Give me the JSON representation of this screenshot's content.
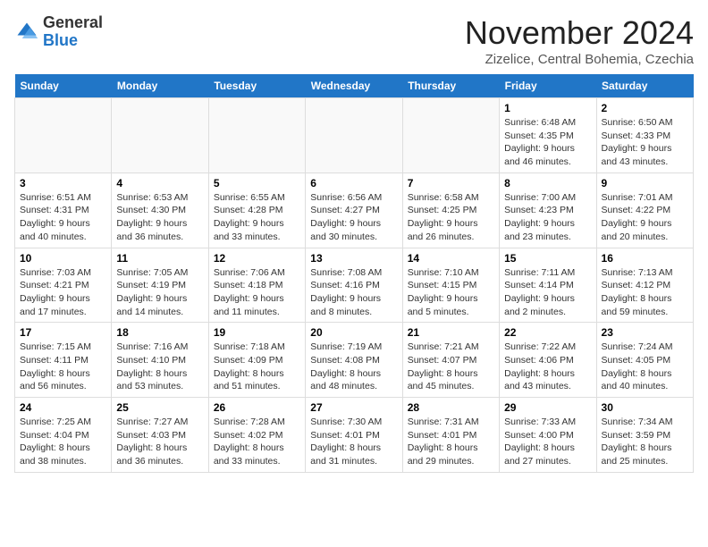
{
  "header": {
    "logo_general": "General",
    "logo_blue": "Blue",
    "month_title": "November 2024",
    "location": "Zizelice, Central Bohemia, Czechia"
  },
  "weekdays": [
    "Sunday",
    "Monday",
    "Tuesday",
    "Wednesday",
    "Thursday",
    "Friday",
    "Saturday"
  ],
  "weeks": [
    [
      {
        "day": "",
        "info": ""
      },
      {
        "day": "",
        "info": ""
      },
      {
        "day": "",
        "info": ""
      },
      {
        "day": "",
        "info": ""
      },
      {
        "day": "",
        "info": ""
      },
      {
        "day": "1",
        "info": "Sunrise: 6:48 AM\nSunset: 4:35 PM\nDaylight: 9 hours and 46 minutes."
      },
      {
        "day": "2",
        "info": "Sunrise: 6:50 AM\nSunset: 4:33 PM\nDaylight: 9 hours and 43 minutes."
      }
    ],
    [
      {
        "day": "3",
        "info": "Sunrise: 6:51 AM\nSunset: 4:31 PM\nDaylight: 9 hours and 40 minutes."
      },
      {
        "day": "4",
        "info": "Sunrise: 6:53 AM\nSunset: 4:30 PM\nDaylight: 9 hours and 36 minutes."
      },
      {
        "day": "5",
        "info": "Sunrise: 6:55 AM\nSunset: 4:28 PM\nDaylight: 9 hours and 33 minutes."
      },
      {
        "day": "6",
        "info": "Sunrise: 6:56 AM\nSunset: 4:27 PM\nDaylight: 9 hours and 30 minutes."
      },
      {
        "day": "7",
        "info": "Sunrise: 6:58 AM\nSunset: 4:25 PM\nDaylight: 9 hours and 26 minutes."
      },
      {
        "day": "8",
        "info": "Sunrise: 7:00 AM\nSunset: 4:23 PM\nDaylight: 9 hours and 23 minutes."
      },
      {
        "day": "9",
        "info": "Sunrise: 7:01 AM\nSunset: 4:22 PM\nDaylight: 9 hours and 20 minutes."
      }
    ],
    [
      {
        "day": "10",
        "info": "Sunrise: 7:03 AM\nSunset: 4:21 PM\nDaylight: 9 hours and 17 minutes."
      },
      {
        "day": "11",
        "info": "Sunrise: 7:05 AM\nSunset: 4:19 PM\nDaylight: 9 hours and 14 minutes."
      },
      {
        "day": "12",
        "info": "Sunrise: 7:06 AM\nSunset: 4:18 PM\nDaylight: 9 hours and 11 minutes."
      },
      {
        "day": "13",
        "info": "Sunrise: 7:08 AM\nSunset: 4:16 PM\nDaylight: 9 hours and 8 minutes."
      },
      {
        "day": "14",
        "info": "Sunrise: 7:10 AM\nSunset: 4:15 PM\nDaylight: 9 hours and 5 minutes."
      },
      {
        "day": "15",
        "info": "Sunrise: 7:11 AM\nSunset: 4:14 PM\nDaylight: 9 hours and 2 minutes."
      },
      {
        "day": "16",
        "info": "Sunrise: 7:13 AM\nSunset: 4:12 PM\nDaylight: 8 hours and 59 minutes."
      }
    ],
    [
      {
        "day": "17",
        "info": "Sunrise: 7:15 AM\nSunset: 4:11 PM\nDaylight: 8 hours and 56 minutes."
      },
      {
        "day": "18",
        "info": "Sunrise: 7:16 AM\nSunset: 4:10 PM\nDaylight: 8 hours and 53 minutes."
      },
      {
        "day": "19",
        "info": "Sunrise: 7:18 AM\nSunset: 4:09 PM\nDaylight: 8 hours and 51 minutes."
      },
      {
        "day": "20",
        "info": "Sunrise: 7:19 AM\nSunset: 4:08 PM\nDaylight: 8 hours and 48 minutes."
      },
      {
        "day": "21",
        "info": "Sunrise: 7:21 AM\nSunset: 4:07 PM\nDaylight: 8 hours and 45 minutes."
      },
      {
        "day": "22",
        "info": "Sunrise: 7:22 AM\nSunset: 4:06 PM\nDaylight: 8 hours and 43 minutes."
      },
      {
        "day": "23",
        "info": "Sunrise: 7:24 AM\nSunset: 4:05 PM\nDaylight: 8 hours and 40 minutes."
      }
    ],
    [
      {
        "day": "24",
        "info": "Sunrise: 7:25 AM\nSunset: 4:04 PM\nDaylight: 8 hours and 38 minutes."
      },
      {
        "day": "25",
        "info": "Sunrise: 7:27 AM\nSunset: 4:03 PM\nDaylight: 8 hours and 36 minutes."
      },
      {
        "day": "26",
        "info": "Sunrise: 7:28 AM\nSunset: 4:02 PM\nDaylight: 8 hours and 33 minutes."
      },
      {
        "day": "27",
        "info": "Sunrise: 7:30 AM\nSunset: 4:01 PM\nDaylight: 8 hours and 31 minutes."
      },
      {
        "day": "28",
        "info": "Sunrise: 7:31 AM\nSunset: 4:01 PM\nDaylight: 8 hours and 29 minutes."
      },
      {
        "day": "29",
        "info": "Sunrise: 7:33 AM\nSunset: 4:00 PM\nDaylight: 8 hours and 27 minutes."
      },
      {
        "day": "30",
        "info": "Sunrise: 7:34 AM\nSunset: 3:59 PM\nDaylight: 8 hours and 25 minutes."
      }
    ]
  ]
}
